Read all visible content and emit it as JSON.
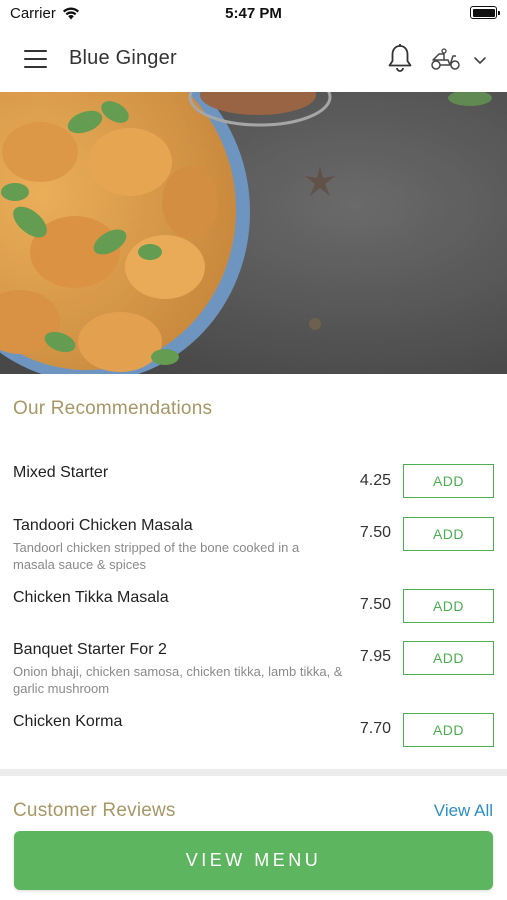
{
  "status_bar": {
    "carrier": "Carrier",
    "time": "5:47 PM"
  },
  "header": {
    "title": "Blue Ginger",
    "icons": [
      "menu-icon",
      "bell-icon",
      "scooter-icon",
      "chevron-down-icon"
    ]
  },
  "recommendations": {
    "title": "Our Recommendations",
    "items": [
      {
        "name": "Mixed Starter",
        "description": "",
        "price": "4.25",
        "button": "ADD"
      },
      {
        "name": "Tandoori Chicken Masala",
        "description": "Tandoorl chicken stripped of the bone cooked in a masala sauce & spices",
        "price": "7.50",
        "button": "ADD"
      },
      {
        "name": "Chicken Tikka Masala",
        "description": "",
        "price": "7.50",
        "button": "ADD"
      },
      {
        "name": "Banquet Starter For 2",
        "description": "Onion bhaji, chicken samosa, chicken tikka, lamb tikka, & garlic mushroom",
        "price": "7.95",
        "button": "ADD"
      },
      {
        "name": "Chicken Korma",
        "description": "",
        "price": "7.70",
        "button": "ADD"
      }
    ]
  },
  "reviews": {
    "title": "Customer Reviews",
    "view_all": "View All"
  },
  "footer": {
    "view_menu": "VIEW MENU"
  },
  "colors": {
    "accent_green": "#5db55f",
    "section_title": "#a69766",
    "link_blue": "#2b8fc7"
  }
}
